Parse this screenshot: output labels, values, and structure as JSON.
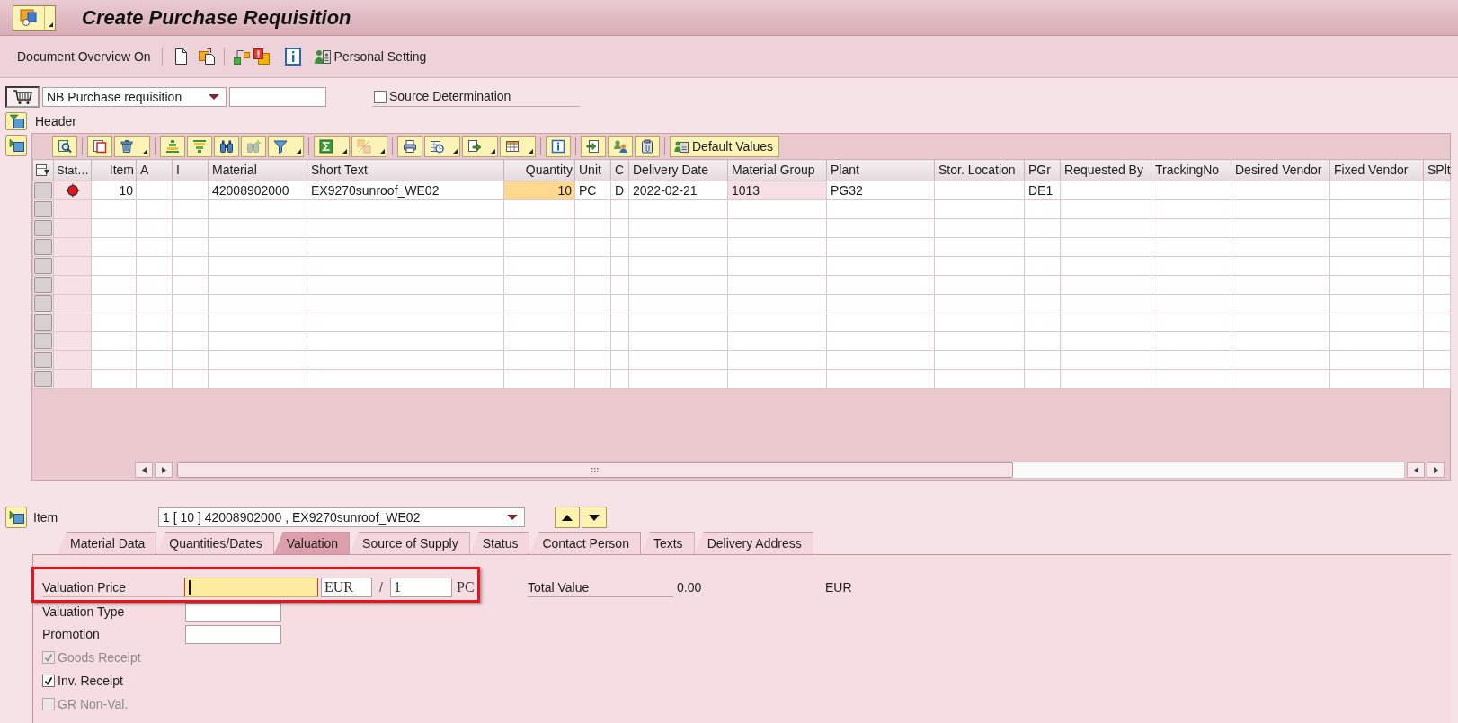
{
  "window": {
    "title": "Create Purchase Requisition"
  },
  "toolbar": {
    "document_overview_button": "Document Overview On",
    "personal_setting_button": "Personal Setting"
  },
  "document_type": {
    "value": "NB Purchase requisition"
  },
  "source_determination": {
    "label": "Source Determination",
    "checked": false
  },
  "header": {
    "label": "Header",
    "expanded": false
  },
  "table_toolbar": {
    "groups": [
      [
        {
          "disabled": false,
          "menu": false
        }
      ],
      [
        {
          "disabled": false,
          "menu": false
        },
        {
          "disabled": false,
          "menu": true
        }
      ],
      [
        {
          "disabled": false,
          "menu": false
        },
        {
          "disabled": false,
          "menu": false
        },
        {
          "disabled": false,
          "menu": false
        },
        {
          "disabled": true,
          "menu": false
        },
        {
          "disabled": false,
          "menu": true
        }
      ],
      [
        {
          "disabled": false,
          "menu": true
        },
        {
          "disabled": true,
          "menu": true
        }
      ],
      [
        {
          "disabled": false,
          "menu": false
        },
        {
          "disabled": false,
          "menu": true
        },
        {
          "disabled": false,
          "menu": true
        },
        {
          "disabled": false,
          "menu": true
        }
      ],
      [
        {
          "disabled": false,
          "menu": false
        }
      ],
      [
        {
          "disabled": false,
          "menu": false
        },
        {
          "disabled": false,
          "menu": false
        },
        {
          "disabled": false,
          "menu": false
        }
      ]
    ],
    "default_values_button": "Default Values"
  },
  "table": {
    "expanded": true,
    "columns": [
      {
        "kind": "status",
        "label": "Stat…"
      },
      {
        "kind": "text",
        "label": "Item"
      },
      {
        "kind": "text",
        "label": "A"
      },
      {
        "kind": "text",
        "label": "I"
      },
      {
        "kind": "text",
        "label": "Material"
      },
      {
        "kind": "text",
        "label": "Short Text"
      },
      {
        "kind": "text",
        "label": "Quantity"
      },
      {
        "kind": "text",
        "label": "Unit"
      },
      {
        "kind": "text",
        "label": "C"
      },
      {
        "kind": "text",
        "label": "Delivery Date"
      },
      {
        "kind": "text",
        "label": "Material Group"
      },
      {
        "kind": "text",
        "label": "Plant"
      },
      {
        "kind": "text",
        "label": "Stor. Location"
      },
      {
        "kind": "text",
        "label": "PGr"
      },
      {
        "kind": "text",
        "label": "Requested By"
      },
      {
        "kind": "text",
        "label": "TrackingNo"
      },
      {
        "kind": "text",
        "label": "Desired Vendor"
      },
      {
        "kind": "text",
        "label": "Fixed Vendor"
      },
      {
        "kind": "text",
        "label": "SPlt"
      }
    ],
    "rows": [
      {
        "color": "#e8141c",
        "cells": {
          "item": {
            "text": "10"
          },
          "material": {
            "text": "42008902000"
          },
          "short_text": {
            "text": "EX9270sunroof_WE02"
          },
          "quantity": {
            "text": "10",
            "focused": true
          },
          "unit": {
            "text": "PC"
          },
          "c": {
            "text": "D"
          },
          "delivery_date": {
            "text": "2022-02-21"
          },
          "material_group": {
            "text": "1013",
            "readonly": true
          },
          "plant": {
            "text": "PG32"
          },
          "pgr": {
            "text": "DE1"
          }
        }
      }
    ]
  },
  "item": {
    "label": "Item",
    "value": "1 [ 10 ] 42008902000 , EX9270sunroof_WE02",
    "expanded": true
  },
  "tabs": [
    {
      "label": "Material Data",
      "selected": false
    },
    {
      "label": "Quantities/Dates",
      "selected": false
    },
    {
      "label": "Valuation",
      "selected": true
    },
    {
      "label": "Source of Supply",
      "selected": false
    },
    {
      "label": "Status",
      "selected": false
    },
    {
      "label": "Contact Person",
      "selected": false
    },
    {
      "label": "Texts",
      "selected": false
    },
    {
      "label": "Delivery Address",
      "selected": false
    }
  ],
  "valuation": {
    "price": {
      "label": "Valuation Price",
      "focused": true,
      "highlighted": true,
      "currency": "EUR",
      "separator": "/",
      "price_unit": "1",
      "unit": "PC"
    },
    "total_value": {
      "label": "Total Value",
      "value": "0.00",
      "currency": "EUR"
    },
    "fields": [
      {
        "label": "Valuation Type"
      },
      {
        "label": "Promotion"
      }
    ],
    "checkboxes": [
      {
        "label": "Goods Receipt",
        "checked": true,
        "disabled": true
      },
      {
        "label": "Inv. Receipt",
        "checked": true,
        "disabled": false
      },
      {
        "label": "GR Non-Val.",
        "checked": false,
        "disabled": true
      }
    ]
  }
}
